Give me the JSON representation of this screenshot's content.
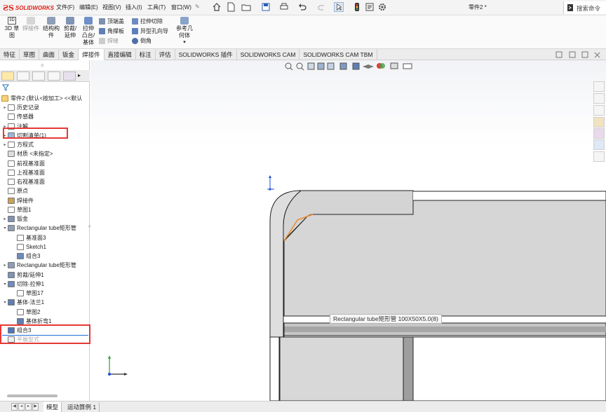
{
  "app": {
    "logo_text": "SOLIDWORKS",
    "doc_title": "零件2 *",
    "search_placeholder": "搜索命令"
  },
  "menu": [
    "文件(F)",
    "编辑(E)",
    "视图(V)",
    "插入(I)",
    "工具(T)",
    "窗口(W)"
  ],
  "ribbon": {
    "sketch3d": "3D 草图",
    "weld_part": "焊接件",
    "structure": "结构构件",
    "trim": "剪裁/延伸",
    "boss": "拉伸凸台/基体",
    "end_cap": "顶端盖",
    "gusset": "角撑板",
    "weld_bead": "焊缝",
    "ext_cut": "拉伸切除",
    "hole_wizard": "异型孔向导",
    "chamfer": "倒角",
    "ref_geom": "参考几何体"
  },
  "tabs": [
    "特征",
    "草图",
    "曲面",
    "钣金",
    "焊接件",
    "直接编辑",
    "标注",
    "评估",
    "SOLIDWORKS 插件",
    "SOLIDWORKS CAM",
    "SOLIDWORKS CAM TBM"
  ],
  "active_tab": "焊接件",
  "tree": {
    "root": "零件2 (默认<按加工> <<默认",
    "items": [
      {
        "label": "历史记录",
        "arrow": "▸"
      },
      {
        "label": "传感器",
        "arrow": ""
      },
      {
        "label": "注解",
        "arrow": "▸"
      },
      {
        "label": "切割清单(1)",
        "arrow": "▸"
      },
      {
        "label": "方程式",
        "arrow": "▸"
      },
      {
        "label": "材质 <未指定>",
        "arrow": ""
      },
      {
        "label": "前视基准面",
        "arrow": ""
      },
      {
        "label": "上视基准面",
        "arrow": ""
      },
      {
        "label": "右视基准面",
        "arrow": ""
      },
      {
        "label": "原点",
        "arrow": ""
      },
      {
        "label": "焊接件",
        "arrow": ""
      },
      {
        "label": "草图1",
        "arrow": ""
      },
      {
        "label": "钣金",
        "arrow": "▸"
      },
      {
        "label": "Rectangular tube矩形管",
        "arrow": "▾"
      },
      {
        "label": "基准面3",
        "arrow": ""
      },
      {
        "label": "Sketch1",
        "arrow": ""
      },
      {
        "label": "组合3",
        "arrow": ""
      },
      {
        "label": "Rectangular tube矩形管",
        "arrow": "▸"
      },
      {
        "label": "剪裁/延伸1",
        "arrow": ""
      },
      {
        "label": "切除-拉伸1",
        "arrow": "▾"
      },
      {
        "label": "草图17",
        "arrow": ""
      },
      {
        "label": "基体-法兰1",
        "arrow": "▾"
      },
      {
        "label": "草图2",
        "arrow": ""
      },
      {
        "label": "基体折弯1",
        "arrow": ""
      },
      {
        "label": "组合3",
        "arrow": ""
      },
      {
        "label": "平展型式",
        "arrow": ""
      }
    ]
  },
  "tooltip": "Rectangular tube矩形管 100X50X5.0(8)",
  "bottom_tabs": [
    "模型",
    "运动算例 1"
  ],
  "colors": {
    "red_box": "#e53935",
    "accent": "#1e6fd9",
    "edge_orange": "#f08a24"
  }
}
